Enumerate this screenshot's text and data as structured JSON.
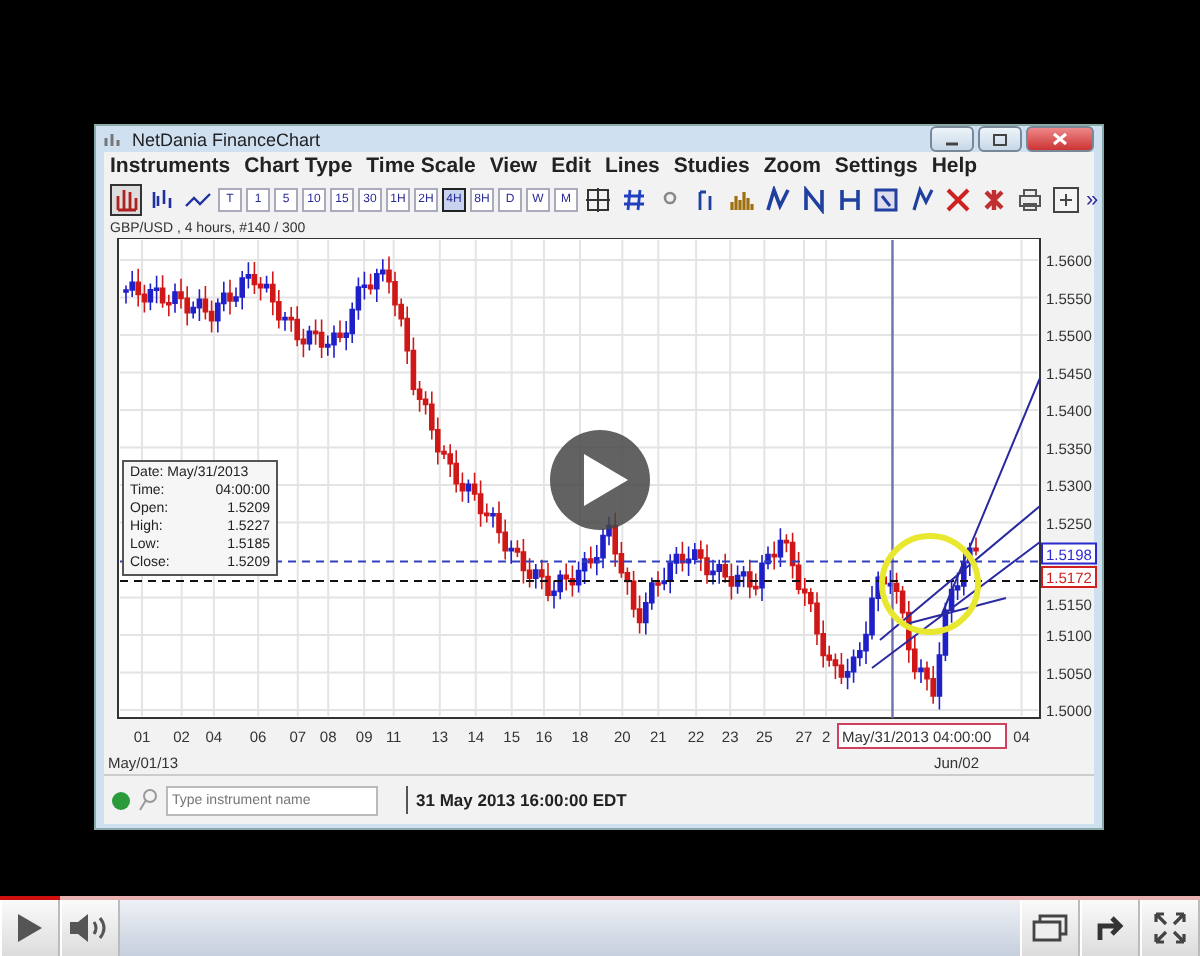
{
  "window": {
    "title": "NetDania FinanceChart"
  },
  "menu": [
    "Instruments",
    "Chart Type",
    "Time Scale",
    "View",
    "Edit",
    "Lines",
    "Studies",
    "Zoom",
    "Settings",
    "Help"
  ],
  "toolbar": {
    "time_scales": [
      {
        "label": "T",
        "selected": false
      },
      {
        "label": "1",
        "selected": false
      },
      {
        "label": "5",
        "selected": false
      },
      {
        "label": "10",
        "selected": false
      },
      {
        "label": "15",
        "selected": false
      },
      {
        "label": "30",
        "selected": false
      },
      {
        "label": "1H",
        "selected": false
      },
      {
        "label": "2H",
        "selected": false
      },
      {
        "label": "4H",
        "selected": true
      },
      {
        "label": "8H",
        "selected": false
      },
      {
        "label": "D",
        "selected": false
      },
      {
        "label": "W",
        "selected": false
      },
      {
        "label": "M",
        "selected": false
      }
    ],
    "more": "»"
  },
  "chart": {
    "header": "GBP/USD , 4 hours, #140 / 300",
    "y_ticks": [
      "1.5600",
      "1.5550",
      "1.5500",
      "1.5450",
      "1.5400",
      "1.5350",
      "1.5300",
      "1.5250",
      "1.5150",
      "1.5100",
      "1.5050",
      "1.5000"
    ],
    "x_ticks": [
      "01",
      "02",
      "04",
      "06",
      "07",
      "08",
      "09",
      "11",
      "13",
      "14",
      "15",
      "16",
      "18",
      "20",
      "21",
      "22",
      "23",
      "25",
      "27",
      "2",
      "04"
    ],
    "x_subs": [
      "May/01/13",
      "Jun/02"
    ],
    "price_tags": [
      {
        "label": "1.5198",
        "color": "#2a2ad0"
      },
      {
        "label": "1.5172",
        "color": "#d02020"
      }
    ],
    "cursor_label": "May/31/2013 04:00:00",
    "info": {
      "date": "Date: May/31/2013",
      "rows": [
        {
          "label": "Time:",
          "value": "04:00:00"
        },
        {
          "label": "Open:",
          "value": "1.5209"
        },
        {
          "label": "High:",
          "value": "1.5227"
        },
        {
          "label": "Low:",
          "value": "1.5185"
        },
        {
          "label": "Close:",
          "value": "1.5209"
        }
      ]
    }
  },
  "status_bar": {
    "connected": true,
    "search_placeholder": "Type instrument name",
    "datetime": "31 May 2013 16:00:00 EDT"
  },
  "player": {
    "progress": {
      "level": 0.05
    }
  }
}
